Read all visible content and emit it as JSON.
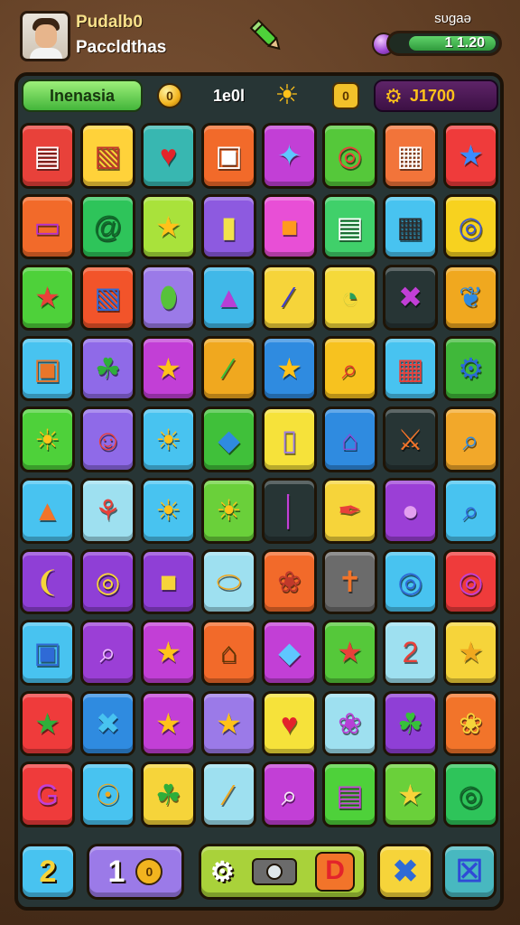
{
  "header": {
    "player_name": "Pudalb0",
    "player_sub": "Paccldthas",
    "score_label": "sυgaə",
    "score_value": "1 1.20",
    "pencil_icon": "pencil-icon",
    "orb_icon": "purple-orb-icon"
  },
  "status": {
    "level_label": "Inenasia",
    "coin_symbol": "0",
    "coins": "1e0l",
    "sun_icon": "sun-icon",
    "box_icon": "chest-icon",
    "box_symbol": "0",
    "gear_icon": "gear-icon",
    "total": "J1700"
  },
  "tiles": [
    {
      "g": "▤",
      "bg": "#e8413a",
      "fg": "#fff"
    },
    {
      "g": "▧",
      "bg": "#ffd23a",
      "fg": "#c0392b"
    },
    {
      "g": "♥",
      "bg": "#38b7b1",
      "fg": "#e3242b"
    },
    {
      "g": "▣",
      "bg": "#f26a2a",
      "fg": "#fff"
    },
    {
      "g": "✦",
      "bg": "#c23fd6",
      "fg": "#5fc6ff"
    },
    {
      "g": "◎",
      "bg": "#55c83a",
      "fg": "#e8413a"
    },
    {
      "g": "▦",
      "bg": "#f2743a",
      "fg": "#fff"
    },
    {
      "g": "★",
      "bg": "#ef3b3b",
      "fg": "#3b8bff"
    },
    {
      "g": "▭",
      "bg": "#f26a2a",
      "fg": "#b52fd0"
    },
    {
      "g": "@",
      "bg": "#2ec45a",
      "fg": "#0f6b2a"
    },
    {
      "g": "★",
      "bg": "#a9e23b",
      "fg": "#ffc21a"
    },
    {
      "g": "▮",
      "bg": "#8d5ae0",
      "fg": "#f2e24a"
    },
    {
      "g": "■",
      "bg": "#e84fd6",
      "fg": "#ff9a1f"
    },
    {
      "g": "▤",
      "bg": "#40d06a",
      "fg": "#fff"
    },
    {
      "g": "▦",
      "bg": "#48c3f0",
      "fg": "#2b2b2b"
    },
    {
      "g": "◎",
      "bg": "#f7d21f",
      "fg": "#3d5ad6"
    },
    {
      "g": "★",
      "bg": "#4ed13a",
      "fg": "#e8413a"
    },
    {
      "g": "▧",
      "bg": "#f2542a",
      "fg": "#2f6ad6"
    },
    {
      "g": "⬮",
      "bg": "#9b7ae8",
      "fg": "#57c23a"
    },
    {
      "g": "▲",
      "bg": "#40b8e8",
      "fg": "#b73fd6"
    },
    {
      "g": "∕",
      "bg": "#f6d43a",
      "fg": "#3b3bd6"
    },
    {
      "g": "◔",
      "bg": "#f5d93a",
      "fg": "#2b9e5a"
    },
    {
      "g": "✖",
      "bg": "#273535",
      "fg": "#c13fd6"
    },
    {
      "g": "❦",
      "bg": "#f0a81f",
      "fg": "#2f8be0"
    },
    {
      "g": "▣",
      "bg": "#48c3f0",
      "fg": "#e8762a"
    },
    {
      "g": "☘",
      "bg": "#8f6ae8",
      "fg": "#2fae3a"
    },
    {
      "g": "★",
      "bg": "#c23fd6",
      "fg": "#ffc21a"
    },
    {
      "g": "∕",
      "bg": "#f0a81f",
      "fg": "#37c13a"
    },
    {
      "g": "★",
      "bg": "#2f8be0",
      "fg": "#ffc21a"
    },
    {
      "g": "⌕",
      "bg": "#f7c21f",
      "fg": "#e23a2a"
    },
    {
      "g": "▦",
      "bg": "#48c3f0",
      "fg": "#e8413a"
    },
    {
      "g": "⚙",
      "bg": "#40b83a",
      "fg": "#2b6ad6"
    },
    {
      "g": "☀",
      "bg": "#4ed13a",
      "fg": "#ffc21a"
    },
    {
      "g": "☺",
      "bg": "#8f6ae8",
      "fg": "#e8413a"
    },
    {
      "g": "☀",
      "bg": "#48c3f0",
      "fg": "#ffc21a"
    },
    {
      "g": "◆",
      "bg": "#40c03a",
      "fg": "#2f8be0"
    },
    {
      "g": "▯",
      "bg": "#f6e23a",
      "fg": "#9b7ae8"
    },
    {
      "g": "⌂",
      "bg": "#2f8be0",
      "fg": "#8f4ad6"
    },
    {
      "g": "⚔",
      "bg": "#273535",
      "fg": "#f2742a"
    },
    {
      "g": "⌕",
      "bg": "#f2a82a",
      "fg": "#2f8be0"
    },
    {
      "g": "▲",
      "bg": "#48c3f0",
      "fg": "#f2742a"
    },
    {
      "g": "⚘",
      "bg": "#9ee0f0",
      "fg": "#e8413a"
    },
    {
      "g": "☀",
      "bg": "#48c3f0",
      "fg": "#ffc21a"
    },
    {
      "g": "☀",
      "bg": "#6ad03a",
      "fg": "#ffc21a"
    },
    {
      "g": "│",
      "bg": "#273535",
      "fg": "#c23fd6"
    },
    {
      "g": "✒",
      "bg": "#f6d43a",
      "fg": "#e8413a"
    },
    {
      "g": "●",
      "bg": "#9b3fd6",
      "fg": "#e39ff0"
    },
    {
      "g": "⌕",
      "bg": "#48c3f0",
      "fg": "#2f6ad6"
    },
    {
      "g": "❨",
      "bg": "#8f3fd6",
      "fg": "#f6d43a"
    },
    {
      "g": "◎",
      "bg": "#8f3fd6",
      "fg": "#f6d43a"
    },
    {
      "g": "■",
      "bg": "#8f3fd6",
      "fg": "#f6d43a"
    },
    {
      "g": "⬭",
      "bg": "#9ee0f0",
      "fg": "#f0a81f"
    },
    {
      "g": "❀",
      "bg": "#f26a2a",
      "fg": "#c0392b"
    },
    {
      "g": "✝",
      "bg": "#6b6b6b",
      "fg": "#f2742a"
    },
    {
      "g": "◎",
      "bg": "#48c3f0",
      "fg": "#2f6ad6"
    },
    {
      "g": "◎",
      "bg": "#ef3b3b",
      "fg": "#c23fd6"
    },
    {
      "g": "▣",
      "bg": "#48c3f0",
      "fg": "#2f6ad6"
    },
    {
      "g": "⌕",
      "bg": "#9b3fd6",
      "fg": "#f0c0ff"
    },
    {
      "g": "★",
      "bg": "#c23fd6",
      "fg": "#ffc21a"
    },
    {
      "g": "⌂",
      "bg": "#f26a2a",
      "fg": "#5a3500"
    },
    {
      "g": "◆",
      "bg": "#c23fd6",
      "fg": "#5fc6ff"
    },
    {
      "g": "★",
      "bg": "#55c83a",
      "fg": "#e8413a"
    },
    {
      "g": "2",
      "bg": "#9ee0f0",
      "fg": "#e8413a"
    },
    {
      "g": "★",
      "bg": "#f6d43a",
      "fg": "#f0a81f"
    },
    {
      "g": "★",
      "bg": "#ef3b3b",
      "fg": "#2fae3a"
    },
    {
      "g": "✖",
      "bg": "#2f8be0",
      "fg": "#48c3f0"
    },
    {
      "g": "★",
      "bg": "#c23fd6",
      "fg": "#ffc21a"
    },
    {
      "g": "★",
      "bg": "#9b7ae8",
      "fg": "#ffc21a"
    },
    {
      "g": "♥",
      "bg": "#f6e23a",
      "fg": "#e3242b"
    },
    {
      "g": "❀",
      "bg": "#9ee0f0",
      "fg": "#b73fd6"
    },
    {
      "g": "☘",
      "bg": "#8f3fd6",
      "fg": "#37c13a"
    },
    {
      "g": "❀",
      "bg": "#f2742a",
      "fg": "#f6d43a"
    },
    {
      "g": "G",
      "bg": "#ef3b3b",
      "fg": "#c23fd6"
    },
    {
      "g": "☉",
      "bg": "#48c3f0",
      "fg": "#f0a81f"
    },
    {
      "g": "☘",
      "bg": "#f6d43a",
      "fg": "#2fae3a"
    },
    {
      "g": "∕",
      "bg": "#9ee0f0",
      "fg": "#f0a81f"
    },
    {
      "g": "⌕",
      "bg": "#c23fd6",
      "fg": "#f6f6f6"
    },
    {
      "g": "▤",
      "bg": "#4ed13a",
      "fg": "#c23fd6"
    },
    {
      "g": "★",
      "bg": "#6ad03a",
      "fg": "#f6d43a"
    },
    {
      "g": "◎",
      "bg": "#2ec45a",
      "fg": "#0f6b2a"
    }
  ],
  "bottom": {
    "btn1": "2",
    "btn2_main": "1",
    "btn2_coin": "0",
    "gear_icon": "gear-icon",
    "camera_icon": "camera-icon",
    "btn_d": "D",
    "btn_x": "✖",
    "btn_last": "☒"
  }
}
